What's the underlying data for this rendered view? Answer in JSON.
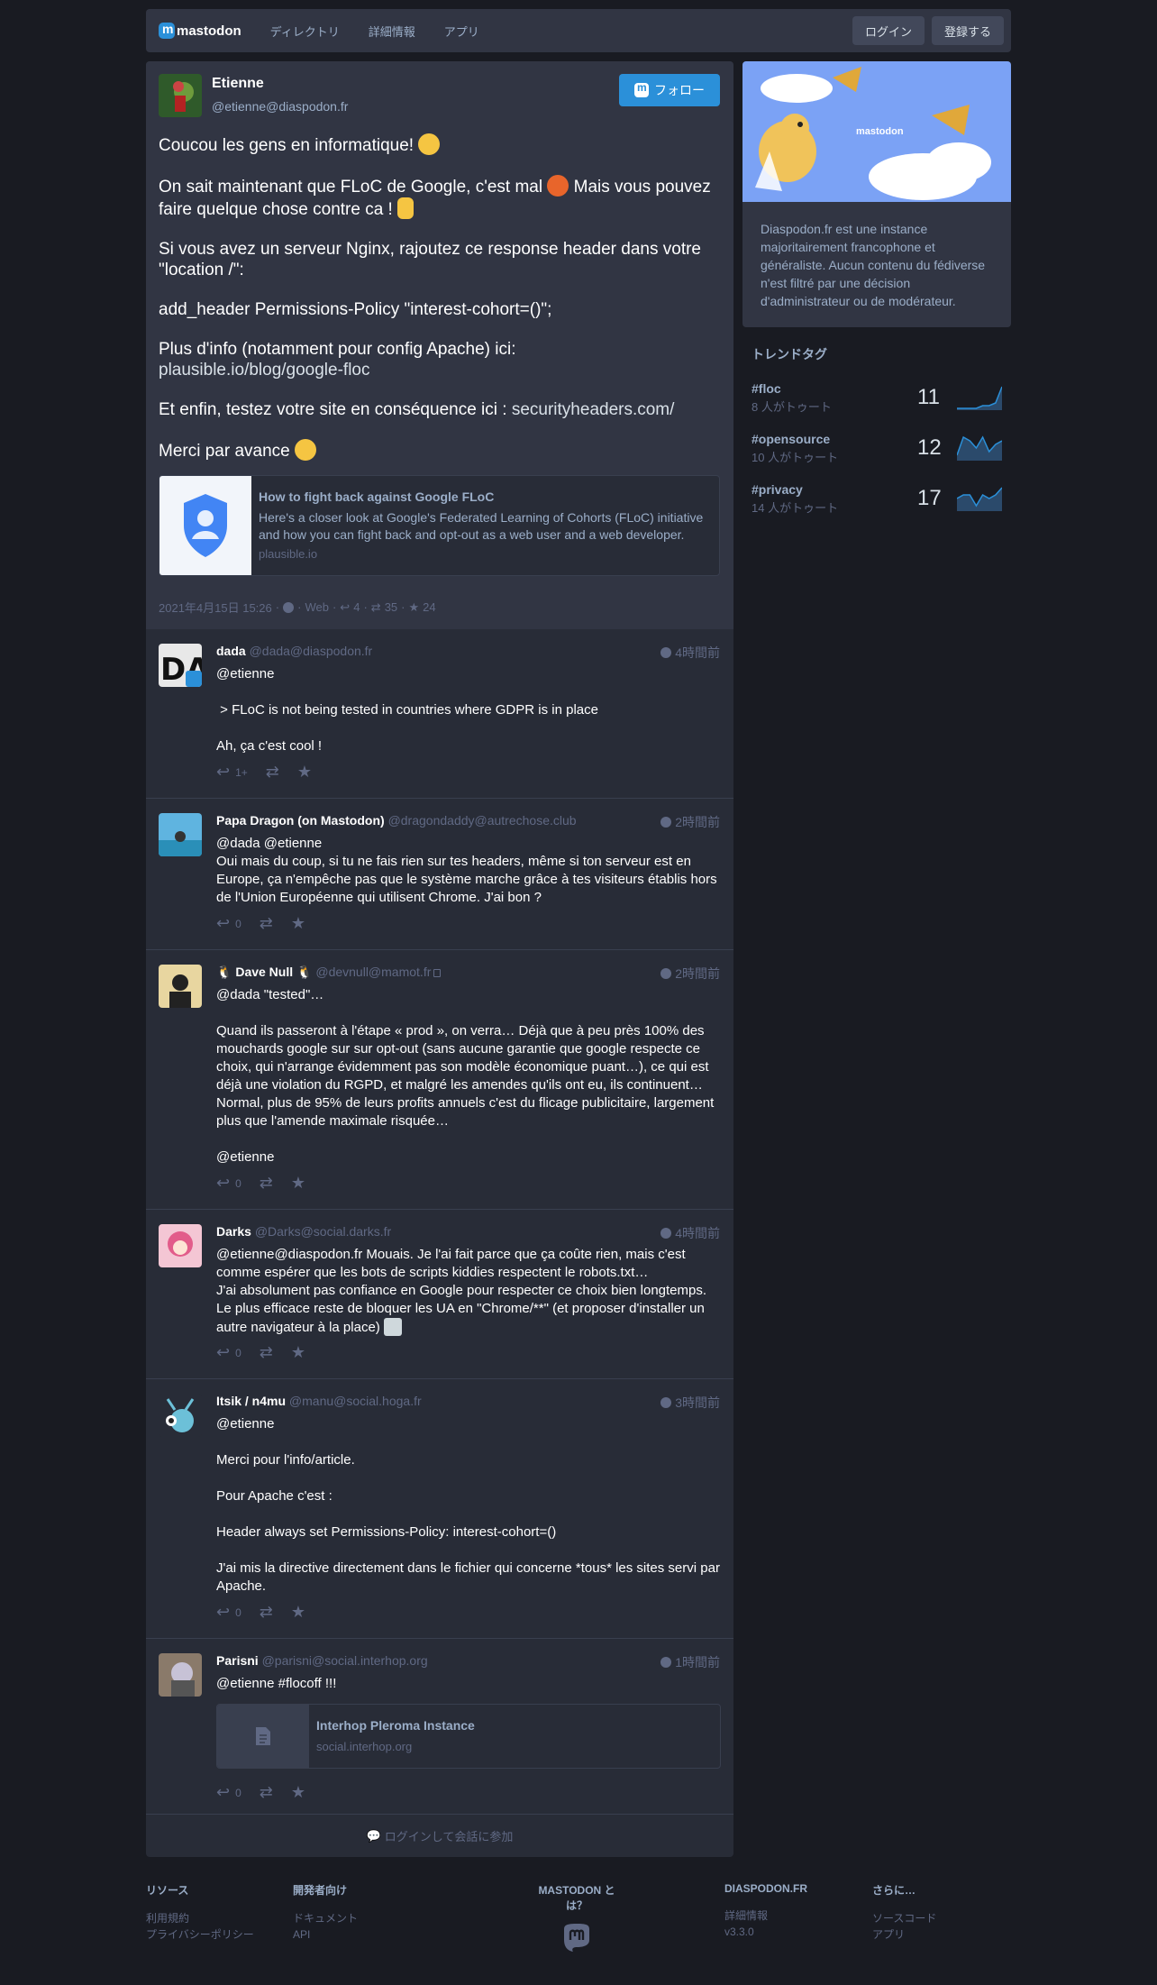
{
  "nav": {
    "logo": "mastodon",
    "links": [
      "ディレクトリ",
      "詳細情報",
      "アプリ"
    ],
    "login": "ログイン",
    "signup": "登録する"
  },
  "detail": {
    "name": "Etienne",
    "acct": "@etienne@diaspodon.fr",
    "follow": "フォロー",
    "paragraphs": {
      "p1": "Coucou les gens en informatique!",
      "p2a": "On sait maintenant que FLoC de Google, c'est mal",
      "p2b": " Mais vous pouvez faire quelque chose contre ca !",
      "p3": "Si vous avez un serveur Nginx, rajoutez ce response header dans votre \"location /\":",
      "p4": "add_header Permissions-Policy \"interest-cohort=()\";",
      "p5": "Plus d'info (notamment pour config Apache) ici:",
      "p5link": "plausible.io/blog/google-floc",
      "p6": "Et enfin, testez votre site en conséquence ici : ",
      "p6link": "securityheaders.com/",
      "p7": "Merci par avance"
    },
    "card": {
      "title": "How to fight back against Google FLoC",
      "desc": "Here's a closer look at Google's Federated Learning of Cohorts (FLoC) initiative and how you can fight back and opt-out as a web user and a web developer.",
      "url": "plausible.io"
    },
    "meta": {
      "date": "2021年4月15日 15:26",
      "app": "Web",
      "replies": "4",
      "boosts": "35",
      "favs": "24"
    }
  },
  "replies": [
    {
      "name": "dada",
      "acct": "@dada@diaspodon.fr",
      "time": "4時間前",
      "content": "@etienne\n\n > FLoC is not being tested in countries where GDPR is in place\n\nAh, ça c'est cool !",
      "count": "1+"
    },
    {
      "name": "Papa Dragon (on Mastodon)",
      "acct": "@dragondaddy@autrechose.club",
      "time": "2時間前",
      "content": "@dada @etienne\nOui mais du coup, si tu ne fais rien sur tes headers, même si ton serveur est en Europe, ça n'empêche pas que le système marche grâce à tes visiteurs établis hors de l'Union Européenne qui utilisent Chrome. J'ai bon ?",
      "count": "0"
    },
    {
      "name": "Dave Null",
      "acct": "@devnull@mamot.fr",
      "time": "2時間前",
      "content": "@dada \"tested\"…\n\nQuand ils passeront à l'étape « prod », on verra… Déjà que à peu près 100% des mouchards google sur sur opt-out (sans aucune garantie que google respecte ce choix, qui n'arrange évidemment pas son modèle économique puant…), ce qui est déjà une violation du RGPD, et malgré les amendes qu'ils ont eu, ils continuent… Normal, plus de 95% de leurs profits annuels c'est du flicage publicitaire, largement plus que l'amende maximale risquée…\n\n@etienne",
      "count": "0"
    },
    {
      "name": "Darks",
      "acct": "@Darks@social.darks.fr",
      "time": "4時間前",
      "content": "@etienne@diaspodon.fr Mouais. Je l'ai fait parce que ça coûte rien, mais c'est comme espérer que les bots de scripts kiddies respectent le robots.txt…\nJ'ai absolument pas confiance en Google pour respecter ce choix bien longtemps. Le plus efficace reste de bloquer les UA en \"Chrome/**\" (et proposer d'installer un autre navigateur à la place)",
      "count": "0"
    },
    {
      "name": "Itsik / n4mu",
      "acct": "@manu@social.hoga.fr",
      "time": "3時間前",
      "content": "@etienne\n\nMerci pour l'info/article.\n\nPour Apache c'est :\n\nHeader always set Permissions-Policy: interest-cohort=()\n\nJ'ai mis la directive directement dans le fichier qui concerne *tous* les sites servi par Apache.",
      "count": "0"
    },
    {
      "name": "Parisni",
      "acct": "@parisni@social.interhop.org",
      "time": "1時間前",
      "content": "@etienne #flocoff !!!",
      "count": "0",
      "card": {
        "title": "Interhop Pleroma Instance",
        "url": "social.interhop.org"
      }
    }
  ],
  "join": "ログインして会話に参加",
  "sidebar": {
    "description": "Diaspodon.fr est une instance majoritairement francophone et généraliste. Aucun contenu du fédiverse n'est filtré par une décision d'administrateur ou de modérateur.",
    "hero_logo": "mastodon",
    "trends_title": "トレンドタグ",
    "trends": [
      {
        "tag": "#floc",
        "sub": "8 人がトゥート",
        "count": "11",
        "spark": [
          0,
          0,
          0,
          0,
          1,
          1,
          2,
          8
        ]
      },
      {
        "tag": "#opensource",
        "sub": "10 人がトゥート",
        "count": "12",
        "spark": [
          1,
          6,
          5,
          3,
          6,
          2,
          4,
          5
        ]
      },
      {
        "tag": "#privacy",
        "sub": "14 人がトゥート",
        "count": "17",
        "spark": [
          3,
          4,
          4,
          1,
          4,
          3,
          4,
          6
        ]
      }
    ]
  },
  "footer": {
    "resources": {
      "title": "リソース",
      "items": [
        "利用規約",
        "プライバシーポリシー"
      ]
    },
    "dev": {
      "title": "開発者向け",
      "items": [
        "ドキュメント",
        "API"
      ]
    },
    "about": {
      "title": "MASTODON とは？"
    },
    "instance": {
      "title": "DIASPODON.FR",
      "items": [
        "詳細情報",
        "v3.3.0"
      ]
    },
    "more": {
      "title": "さらに…",
      "items": [
        "ソースコード",
        "アプリ"
      ]
    }
  },
  "colors": {
    "bg": "#191b22",
    "panel": "#282c37",
    "raised": "#313543",
    "accent": "#2b90d9",
    "muted": "#606984",
    "light": "#9baec8"
  }
}
